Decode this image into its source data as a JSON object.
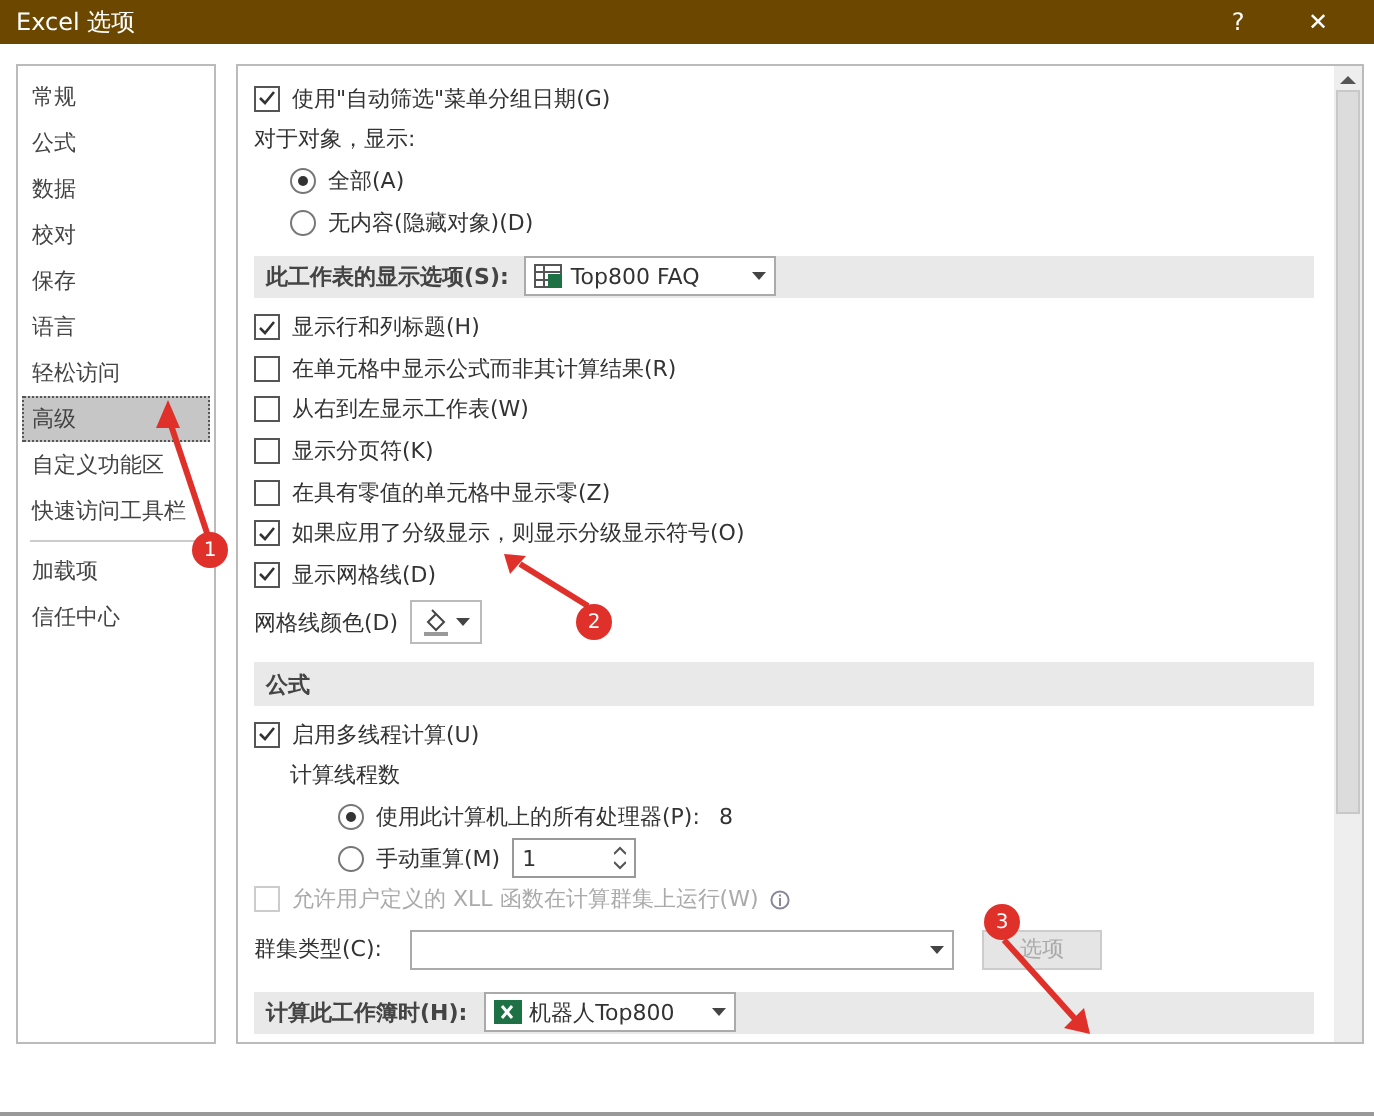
{
  "window": {
    "title": "Excel 选项",
    "help": "?",
    "close": "✕"
  },
  "sidebar": {
    "groups": [
      [
        {
          "label": "常规",
          "selected": false
        },
        {
          "label": "公式",
          "selected": false
        },
        {
          "label": "数据",
          "selected": false
        },
        {
          "label": "校对",
          "selected": false
        },
        {
          "label": "保存",
          "selected": false
        },
        {
          "label": "语言",
          "selected": false
        },
        {
          "label": "轻松访问",
          "selected": false
        },
        {
          "label": "高级",
          "selected": true
        },
        {
          "label": "自定义功能区",
          "selected": false
        },
        {
          "label": "快速访问工具栏",
          "selected": false
        }
      ],
      [
        {
          "label": "加载项",
          "selected": false
        },
        {
          "label": "信任中心",
          "selected": false
        }
      ]
    ]
  },
  "sections": [
    {
      "rows": [
        {
          "kind": "checkbox",
          "label": "使用\"自动筛选\"菜单分组日期(G)",
          "checked": true,
          "disabled": false
        },
        {
          "kind": "label",
          "label": "对于对象，显示:"
        },
        {
          "kind": "radio",
          "label": "全部(A)",
          "selected": true
        },
        {
          "kind": "radio",
          "label": "无内容(隐藏对象)(D)",
          "selected": false
        }
      ]
    },
    {
      "header": "此工作表的显示选项(S):",
      "header_dropdown": "Top800 FAQ",
      "kind": "sheet",
      "rows": [
        {
          "kind": "checkbox",
          "label": "显示行和列标题(H)",
          "checked": true,
          "disabled": false
        },
        {
          "kind": "checkbox",
          "label": "在单元格中显示公式而非其计算结果(R)",
          "checked": false,
          "disabled": false
        },
        {
          "kind": "checkbox",
          "label": "从右到左显示工作表(W)",
          "checked": false,
          "disabled": false
        },
        {
          "kind": "checkbox",
          "label": "显示分页符(K)",
          "checked": false,
          "disabled": false
        },
        {
          "kind": "checkbox",
          "label": "在具有零值的单元格中显示零(Z)",
          "checked": false,
          "disabled": false
        },
        {
          "kind": "checkbox",
          "label": "如果应用了分级显示，则显示分级显示符号(O)",
          "checked": true,
          "disabled": false
        },
        {
          "kind": "checkbox",
          "label": "显示网格线(D)",
          "checked": true,
          "disabled": false
        },
        {
          "kind": "color",
          "label": "网格线颜色(D)"
        }
      ]
    },
    {
      "header": "公式",
      "rows": [
        {
          "kind": "checkbox",
          "label": "启用多线程计算(U)",
          "checked": true,
          "disabled": false
        },
        {
          "kind": "sublabel",
          "label": "计算线程数"
        },
        {
          "kind": "radio2",
          "label": "使用此计算机上的所有处理器(P):",
          "value": "8",
          "selected": true
        },
        {
          "kind": "spin",
          "label": "手动重算(M)",
          "value": "1",
          "selected": false
        },
        {
          "kind": "checkbox",
          "label": "允许用户定义的 XLL 函数在计算群集上运行(W)",
          "checked": false,
          "disabled": true,
          "info": true
        },
        {
          "kind": "cluster",
          "label": "群集类型(C):",
          "button": "选项"
        }
      ]
    },
    {
      "header": "计算此工作簿时(H):",
      "header_dropdown": "机器人Top800",
      "kind": "workbook"
    }
  ],
  "annotations": [
    {
      "number": "1"
    },
    {
      "number": "2"
    },
    {
      "number": "3"
    }
  ]
}
